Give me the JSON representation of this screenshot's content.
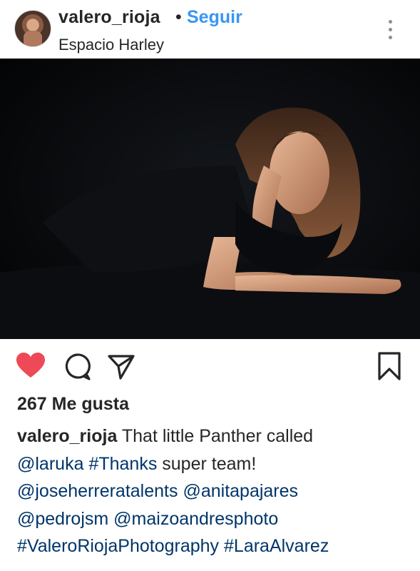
{
  "post": {
    "username": "valero_rioja",
    "separator": "•",
    "follow_label": "Seguir",
    "location": "Espacio Harley"
  },
  "actions": {
    "like_icon": "heart-filled-icon",
    "comment_icon": "comment-icon",
    "share_icon": "share-icon",
    "save_icon": "bookmark-icon",
    "like_color": "#ed4956"
  },
  "likes": "267 Me gusta",
  "caption": {
    "username": "valero_rioja",
    "line1_text": "That little Panther called",
    "mention_laruka": "@laruka",
    "hashtag_thanks": "#Thanks",
    "text_super_team": "super team!",
    "mention_jose": "@joseherreratalents",
    "mention_anita": "@anitapajares",
    "mention_pedro": "@pedrojsm",
    "mention_maizo": "@maizoandresphoto",
    "hashtag_valero": "#ValeroRiojaPhotography",
    "hashtag_lara": "#LaraAlvarez"
  },
  "colors": {
    "link": "#003569",
    "follow": "#3897f0",
    "text": "#262626"
  }
}
